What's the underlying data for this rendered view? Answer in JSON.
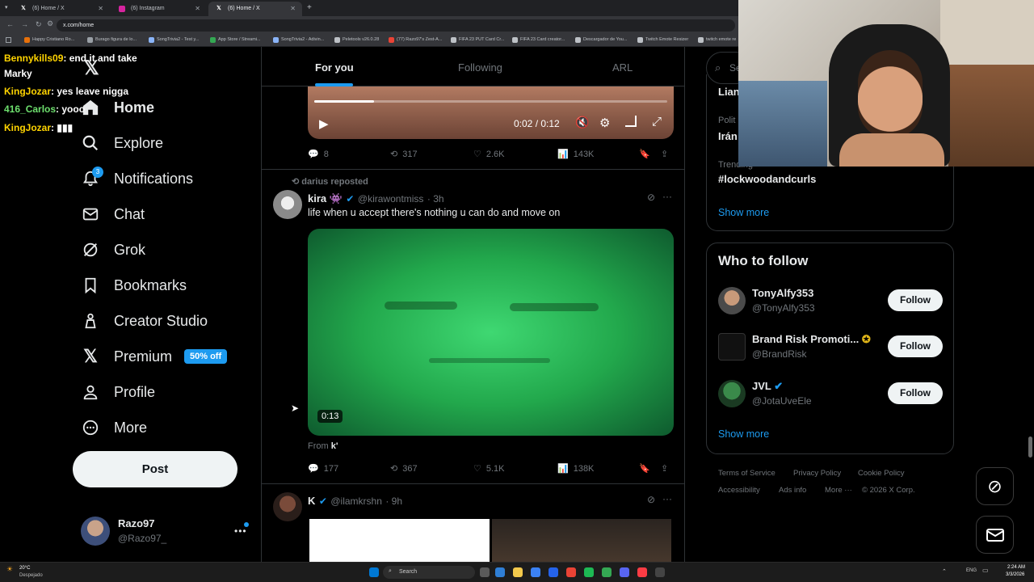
{
  "browser": {
    "tabs": [
      {
        "title": "(6) Home / X",
        "icon": "x-logo",
        "active": false
      },
      {
        "title": "(6) Instagram",
        "icon": "instagram-logo",
        "active": false
      },
      {
        "title": "(6) Home / X",
        "icon": "x-logo",
        "active": true
      }
    ],
    "url": "x.com/home",
    "bookmarks": [
      "Happy Cristiano Ro...",
      "Burago figura de lo...",
      "SongTrivia2 - Test y...",
      "App Store / Streami...",
      "SongTrivia2 - Adivin...",
      "Peletools v26.0.28",
      "(77) Razo97's Zest-A...",
      "FIFA 23 PUT Card Cr...",
      "FIFA 23 Card creator...",
      "Descargador de You...",
      "Twitch Emote Resizer",
      "twitch emote re"
    ]
  },
  "chat": [
    {
      "user": "Bennykills09",
      "message": ": end it and take"
    },
    {
      "user": "",
      "message": "Marky"
    },
    {
      "user": "KingJozar",
      "message": ": yes leave nigga"
    },
    {
      "user": "416_Carlos",
      "message": ": yooo"
    },
    {
      "user": "KingJozar",
      "message": ": ▮▮▮"
    }
  ],
  "sidebar": {
    "items": [
      {
        "label": "Home",
        "icon": "home-icon"
      },
      {
        "label": "Explore",
        "icon": "search-icon"
      },
      {
        "label": "Notifications",
        "icon": "bell-icon",
        "badge": "3"
      },
      {
        "label": "Chat",
        "icon": "mail-icon"
      },
      {
        "label": "Grok",
        "icon": "grok-icon"
      },
      {
        "label": "Bookmarks",
        "icon": "bookmark-icon"
      },
      {
        "label": "Creator Studio",
        "icon": "creator-studio-icon"
      },
      {
        "label": "Premium",
        "icon": "x-logo-icon",
        "tag": "50% off"
      },
      {
        "label": "Profile",
        "icon": "person-icon"
      },
      {
        "label": "More",
        "icon": "more-circle-icon"
      }
    ],
    "post_label": "Post",
    "account": {
      "name": "Razo97",
      "handle": "@Razo97_"
    }
  },
  "feed": {
    "tabs": [
      "For you",
      "Following",
      "ARL"
    ],
    "post1": {
      "time": "0:02 / 0:12",
      "progress": 0.17,
      "replies": "8",
      "reposts": "317",
      "likes": "2.6K",
      "views": "143K"
    },
    "post2": {
      "repost_label": "darius reposted",
      "name": "kira 👾",
      "handle": "@kirawontmiss",
      "age": "· 3h",
      "text": "life when u accept there's nothing u can do and move on",
      "video_duration": "0:13",
      "from_label": "From",
      "from_name": "k'",
      "replies": "177",
      "reposts": "367",
      "likes": "5.1K",
      "views": "138K"
    },
    "post3": {
      "name": "K",
      "handle": "@ilamkrshn",
      "age": "· 9h"
    }
  },
  "right": {
    "search_placeholder": "Se",
    "trend_top_name": "Lian",
    "trend_category": "Polit",
    "trend_name2": "Irán",
    "trend3_category": "Trending",
    "trend3_name": "#lockwoodandcurls",
    "show_more": "Show more",
    "who_title": "Who to follow",
    "who": [
      {
        "name": "TonyAlfy353",
        "handle": "@TonyAlfy353",
        "verified": false
      },
      {
        "name": "Brand Risk Promoti...",
        "handle": "@BrandRisk",
        "verified": true
      },
      {
        "name": "JVL",
        "handle": "@JotaUveEle",
        "verified": true
      }
    ],
    "follow_label": "Follow",
    "show_more2": "Show more",
    "footer": [
      "Terms of Service",
      "Privacy Policy",
      "Cookie Policy",
      "Accessibility",
      "Ads info",
      "More ···",
      "© 2026 X Corp."
    ]
  },
  "taskbar": {
    "weather_temp": "20°C",
    "weather_desc": "Despejado",
    "search_label": "Search",
    "lang": "ENG",
    "time": "2:24 AM",
    "date": "3/3/2026"
  },
  "colors": {
    "accent": "#1d9bf0",
    "chat_user": "#ffd400",
    "chat_user_alt": "#6ee06e",
    "video2_green": "#2fbf5a"
  }
}
